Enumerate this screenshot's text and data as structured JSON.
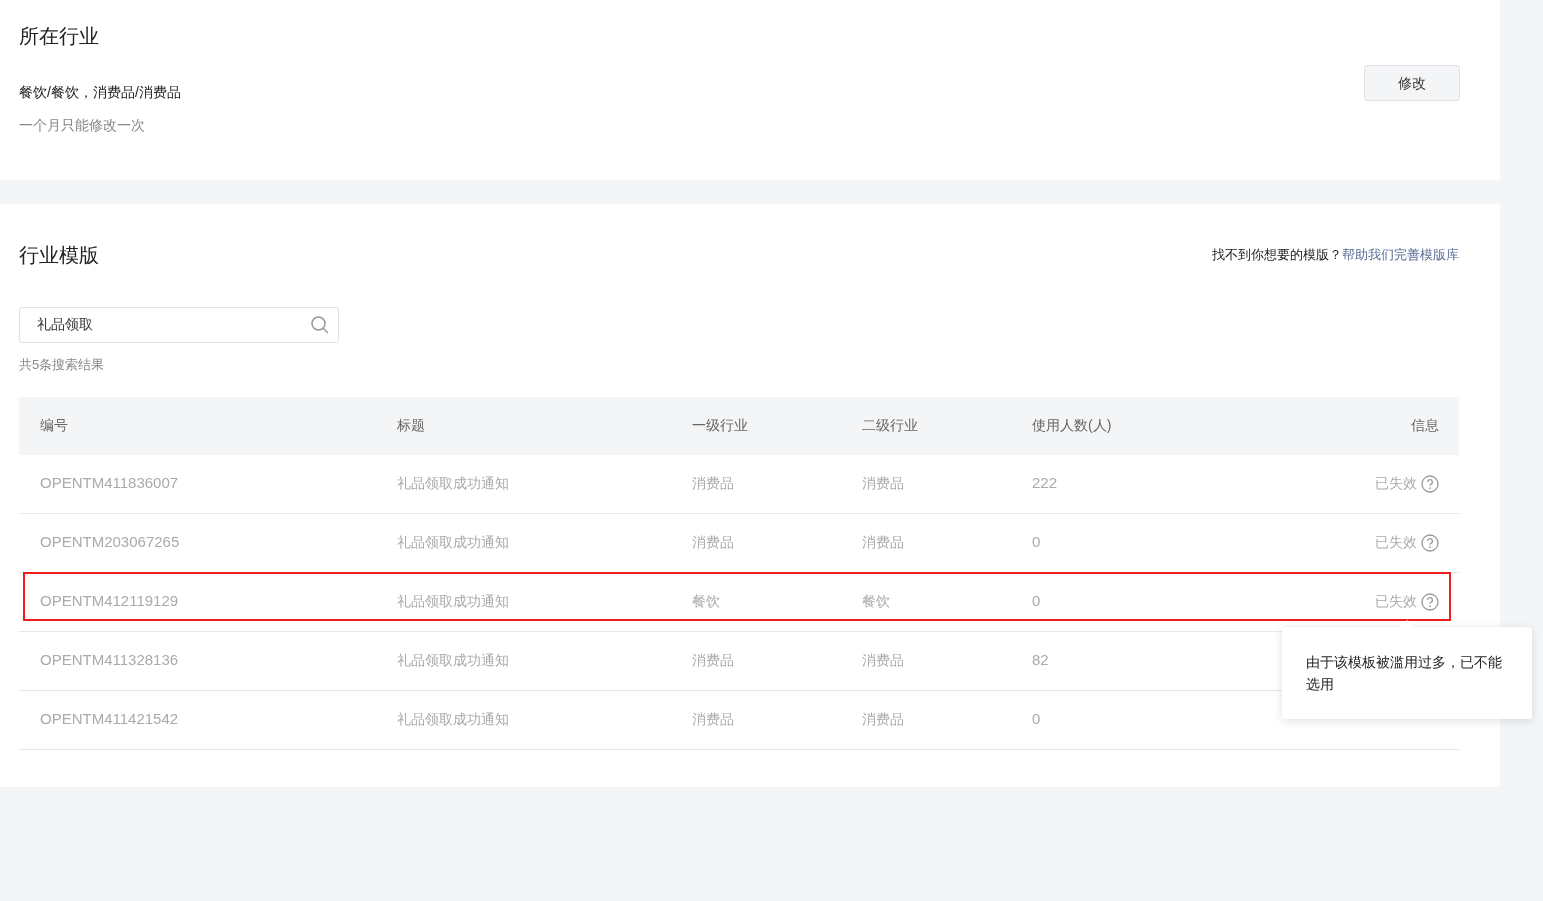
{
  "industry": {
    "title": "所在行业",
    "value": "餐饮/餐饮，消费品/消费品",
    "note": "一个月只能修改一次",
    "edit_button": "修改"
  },
  "templates": {
    "title": "行业模版",
    "help_text": "找不到你想要的模版？",
    "help_link": "帮助我们完善模版库",
    "search": {
      "value": "礼品领取"
    },
    "result_count": "共5条搜索结果",
    "table": {
      "columns": [
        "编号",
        "标题",
        "一级行业",
        "二级行业",
        "使用人数(人)",
        "信息"
      ],
      "rows": [
        {
          "id": "OPENTM411836007",
          "title": "礼品领取成功通知",
          "industry1": "消费品",
          "industry2": "消费品",
          "users": "222",
          "status": "已失效",
          "highlighted": false
        },
        {
          "id": "OPENTM203067265",
          "title": "礼品领取成功通知",
          "industry1": "消费品",
          "industry2": "消费品",
          "users": "0",
          "status": "已失效",
          "highlighted": false
        },
        {
          "id": "OPENTM412119129",
          "title": "礼品领取成功通知",
          "industry1": "餐饮",
          "industry2": "餐饮",
          "users": "0",
          "status": "已失效",
          "highlighted": true,
          "tooltip": "由于该模板被滥用过多，已不能选用"
        },
        {
          "id": "OPENTM411328136",
          "title": "礼品领取成功通知",
          "industry1": "消费品",
          "industry2": "消费品",
          "users": "82",
          "highlighted": false
        },
        {
          "id": "OPENTM411421542",
          "title": "礼品领取成功通知",
          "industry1": "消费品",
          "industry2": "消费品",
          "users": "0",
          "highlighted": false
        }
      ]
    }
  }
}
